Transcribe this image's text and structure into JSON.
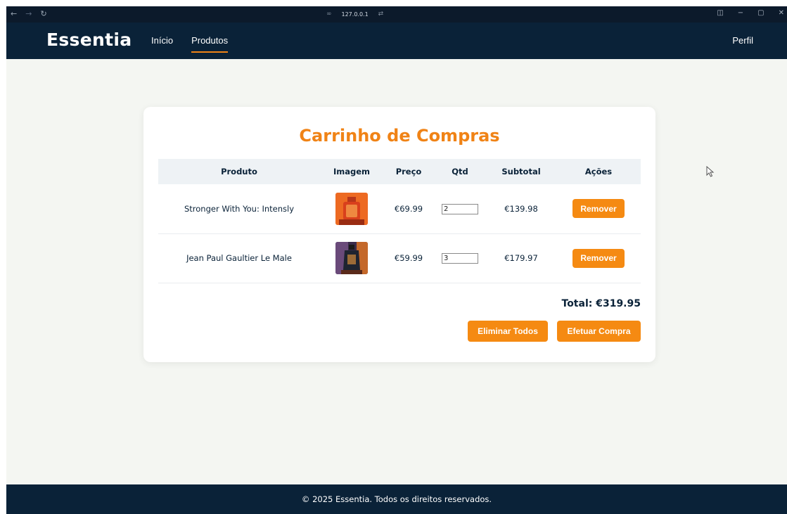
{
  "browser": {
    "address": "127.0.0.1"
  },
  "header": {
    "logo": "Essentia",
    "nav": [
      {
        "label": "Início",
        "active": false
      },
      {
        "label": "Produtos",
        "active": true
      }
    ],
    "profile": "Perfil"
  },
  "cart": {
    "title": "Carrinho de Compras",
    "columns": [
      "Produto",
      "Imagem",
      "Preço",
      "Qtd",
      "Subtotal",
      "Ações"
    ],
    "rows": [
      {
        "product": "Stronger With You: Intensly",
        "price": "€69.99",
        "qty": "2",
        "subtotal": "€139.98",
        "remove_label": "Remover",
        "image_icon": "perfume-bottle-orange"
      },
      {
        "product": "Jean Paul Gaultier Le Male",
        "price": "€59.99",
        "qty": "3",
        "subtotal": "€179.97",
        "remove_label": "Remover",
        "image_icon": "perfume-bottle-purple"
      }
    ],
    "total": "Total: €319.95",
    "clear_all_label": "Eliminar Todos",
    "checkout_label": "Efetuar Compra"
  },
  "footer": {
    "text": "© 2025 Essentia. Todos os direitos reservados."
  },
  "colors": {
    "accent": "#f08316",
    "navy": "#0a2238",
    "page_bg": "#f4f6f2"
  }
}
